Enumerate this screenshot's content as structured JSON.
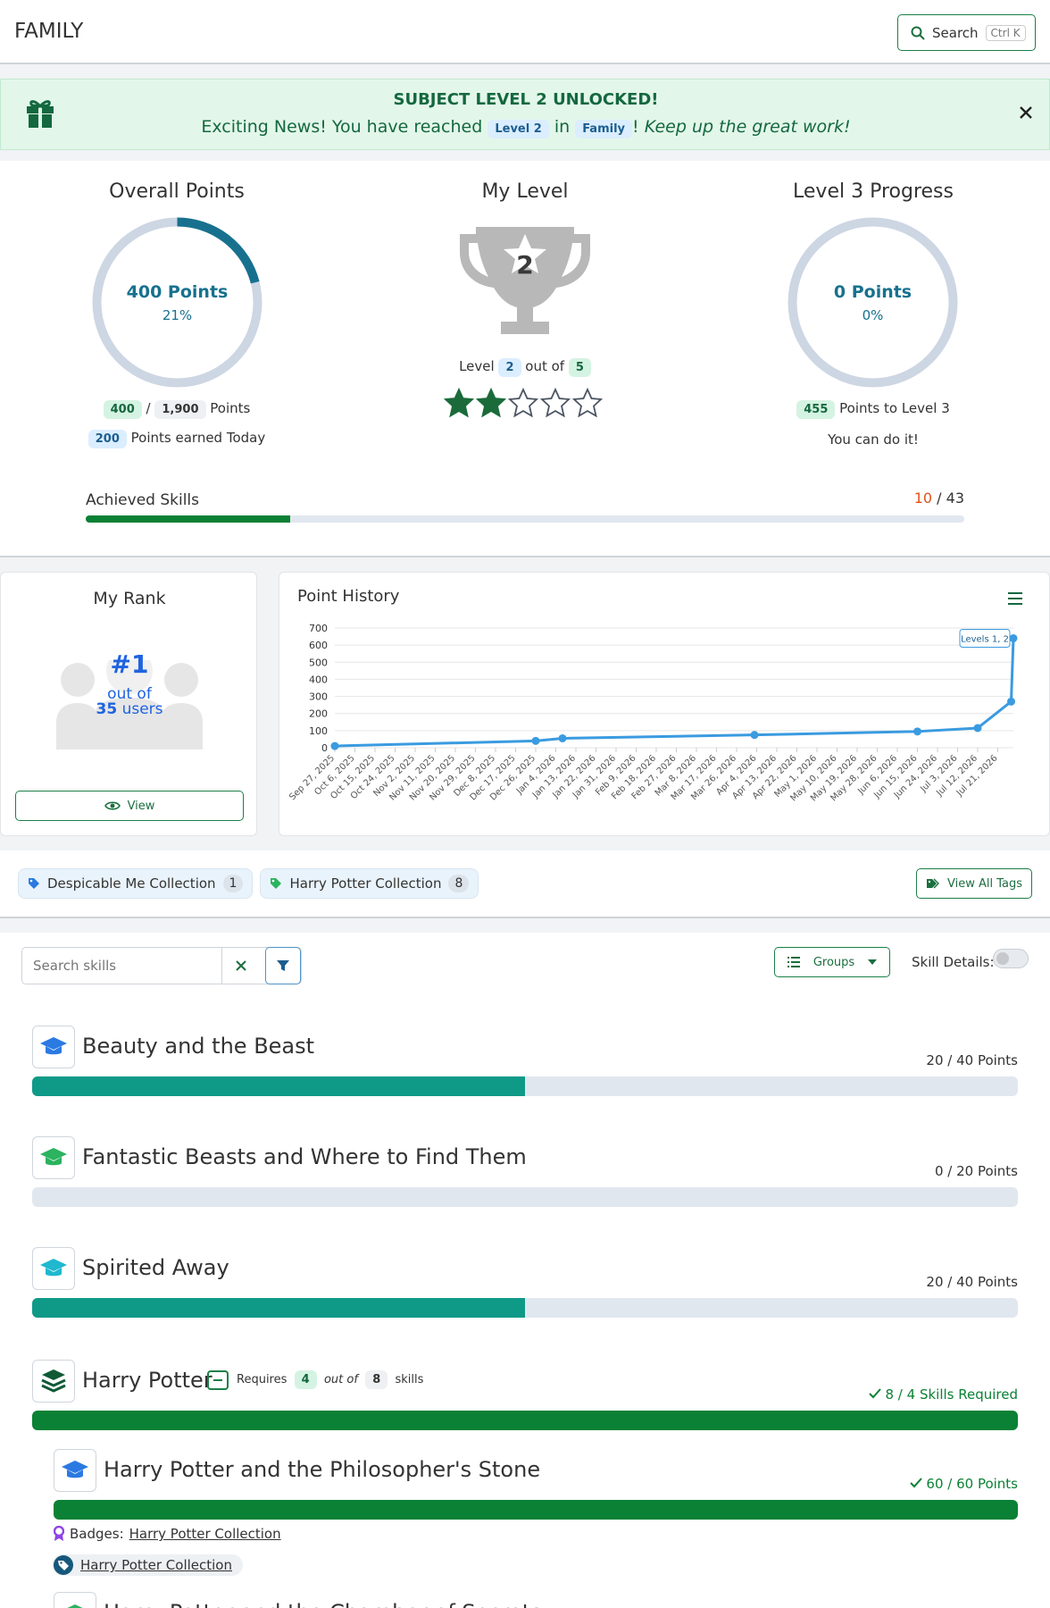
{
  "header": {
    "title": "FAMILY",
    "search_label": "Search",
    "search_shortcut": "Ctrl K"
  },
  "alert": {
    "title": "SUBJECT LEVEL 2 UNLOCKED!",
    "text_before": "Exciting News! You have reached",
    "level_badge": "Level 2",
    "text_in": "in",
    "subject_badge": "Family",
    "bang": "!",
    "text_italic": "Keep up the great work!",
    "close_icon": "close-icon"
  },
  "overall": {
    "title": "Overall Points",
    "ring_points": "400 Points",
    "ring_percent": "21%",
    "percent_value": 0.21,
    "earned": "400",
    "slash": "/",
    "total": "1,900",
    "points_label": "Points",
    "today": "200",
    "today_label": "Points earned Today"
  },
  "level": {
    "title": "My Level",
    "trophy_number": "2",
    "level_label": "Level",
    "level_value": "2",
    "out_of": "out of",
    "max_value": "5",
    "stars_filled": 2,
    "stars_total": 5
  },
  "progress": {
    "title": "Level 3 Progress",
    "ring_points": "0 Points",
    "ring_percent": "0%",
    "percent_value": 0,
    "to_level_value": "455",
    "to_level_label": "Points to Level 3",
    "encourage": "You can do it!"
  },
  "achieved": {
    "label": "Achieved Skills",
    "value": "10",
    "slash": "/",
    "total": "43",
    "fraction": 0.2326
  },
  "rank": {
    "title": "My Rank",
    "rank_number": "#1",
    "out_of": "out of",
    "users_count": "35",
    "users_label": "users",
    "view_label": "View"
  },
  "history": {
    "title": "Point History",
    "menu_icon": "hamburger-icon"
  },
  "chart_data": {
    "type": "line",
    "title": "Point History",
    "xlabel": "",
    "ylabel": "",
    "ylim": [
      0,
      700
    ],
    "yticks": [
      0,
      100,
      200,
      300,
      400,
      500,
      600,
      700
    ],
    "xtick_labels": [
      "Sep 27, 2025",
      "Oct 6, 2025",
      "Oct 15, 2025",
      "Oct 24, 2025",
      "Nov 2, 2025",
      "Nov 11, 2025",
      "Nov 20, 2025",
      "Nov 29, 2025",
      "Dec 8, 2025",
      "Dec 17, 2025",
      "Dec 26, 2025",
      "Jan 4, 2026",
      "Jan 13, 2026",
      "Jan 22, 2026",
      "Jan 31, 2026",
      "Feb 9, 2026",
      "Feb 18, 2026",
      "Feb 27, 2026",
      "Mar 8, 2026",
      "Mar 17, 2026",
      "Mar 26, 2026",
      "Apr 4, 2026",
      "Apr 13, 2026",
      "Apr 22, 2026",
      "May 1, 2026",
      "May 10, 2026",
      "May 19, 2026",
      "May 28, 2026",
      "Jun 6, 2026",
      "Jun 15, 2026",
      "Jun 24, 2026",
      "Jul 3, 2026",
      "Jul 12, 2026",
      "Jul 21, 2026"
    ],
    "series": [
      {
        "x": [
          "Sep 27, 2025",
          "Dec 26, 2025",
          "Jan 7, 2026",
          "Apr 3, 2026",
          "Jun 15, 2026",
          "Jul 12, 2026",
          "Jul 27, 2026",
          "Jul 28, 2026"
        ],
        "values": [
          10,
          40,
          55,
          75,
          95,
          115,
          270,
          640
        ],
        "marker_indices": [
          0,
          1,
          2,
          3,
          4,
          5,
          6,
          7
        ]
      }
    ],
    "annotation": {
      "text": "Levels 1, 2",
      "x": "Jul 28, 2026",
      "y": 640
    },
    "grid": true,
    "legend": "none"
  },
  "tags": [
    {
      "label": "Despicable Me Collection",
      "count": "1",
      "icon": "tag-icon",
      "color": "#2a7ae2"
    },
    {
      "label": "Harry Potter Collection",
      "count": "8",
      "icon": "tag-icon",
      "color": "#2bb35f"
    }
  ],
  "view_all_tags": "View All Tags",
  "filters": {
    "search_placeholder": "Search skills",
    "groups_label": "Groups",
    "skill_details_label": "Skill Details:"
  },
  "skills": [
    {
      "title": "Beauty and the Beast",
      "points": "20 / 40 Points",
      "fraction": 0.5,
      "icon_color": "#2a7ae2"
    },
    {
      "title": "Fantastic Beasts and Where to Find Them",
      "points": "0 / 20 Points",
      "fraction": 0,
      "icon_color": "#2bb35f"
    },
    {
      "title": "Spirited Away",
      "points": "20 / 40 Points",
      "fraction": 0.5,
      "icon_color": "#1fb8cf"
    }
  ],
  "group": {
    "title": "Harry Potter",
    "requires": "Requires",
    "req_count": "4",
    "out_of": "out of",
    "total": "8",
    "skills_word": "skills",
    "required_status": "8 / 4 Skills Required",
    "fraction": 1
  },
  "child_skill": {
    "title": "Harry Potter and the Philosopher's Stone",
    "points": "60 / 60 Points",
    "fraction": 1,
    "badges_label": "Badges:",
    "badge_link": "Harry Potter Collection",
    "tag_link": "Harry Potter Collection"
  },
  "next_skill_partial": {
    "title": "Harry Potter and the Chamber of Secrets"
  },
  "colors": {
    "teal": "#0f9a88",
    "green": "#0a8134",
    "ring": "#17718e",
    "ring_track": "#cdd6e3",
    "chart_line": "#3a9be0"
  }
}
